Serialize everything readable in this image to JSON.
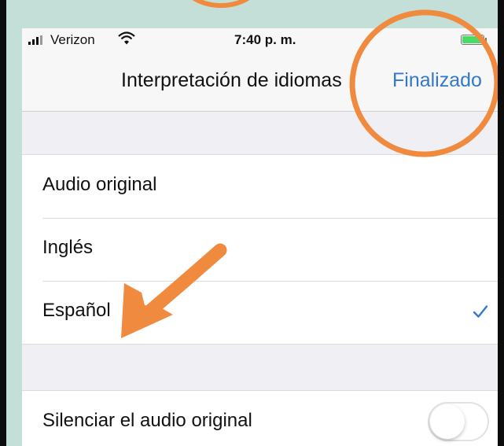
{
  "status_bar": {
    "carrier": "Verizon",
    "time": "7:40 p. m.",
    "icons": [
      "signal-bars-icon",
      "wifi-icon",
      "battery-icon"
    ],
    "battery_color": "#4cd964"
  },
  "nav": {
    "title": "Interpretación de idiomas",
    "done_label": "Finalizado",
    "done_color": "#3478c9"
  },
  "language_options": [
    {
      "label": "Audio original",
      "selected": false
    },
    {
      "label": "Inglés",
      "selected": false
    },
    {
      "label": "Español",
      "selected": true,
      "indicator_icon": "checkmark-icon"
    }
  ],
  "mute_original": {
    "label": "Silenciar el audio original",
    "enabled": false
  },
  "annotations": {
    "color": "#f08a3e",
    "shapes": [
      "circle-around-done",
      "arrow-to-espanol",
      "partial-circle-top"
    ]
  }
}
